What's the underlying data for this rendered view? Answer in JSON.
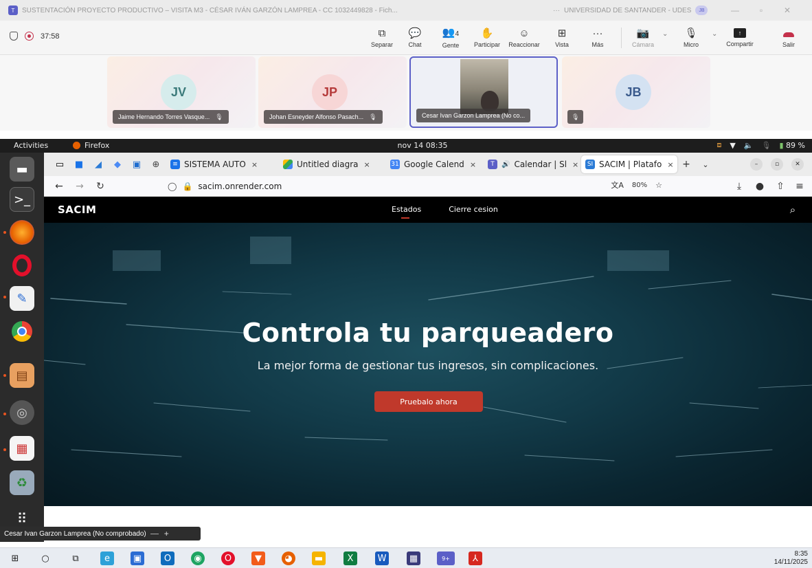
{
  "teams": {
    "window_title": "SUSTENTACIÓN PROYECTO PRODUCTIVO – VISITA M3 - CÉSAR IVÁN GARZÓN LAMPREA - CC 1032449828 - Fich...",
    "more": "···",
    "org": "UNIVERSIDAD DE SANTANDER - UDES",
    "org_badge": "JB",
    "timer": "37:58",
    "toolbar": {
      "separar": "Separar",
      "chat": "Chat",
      "gente": "Gente",
      "gente_count": "4",
      "participar": "Participar",
      "reaccionar": "Reaccionar",
      "vista": "Vista",
      "mas": "Más",
      "camara": "Cámara",
      "micro": "Micro",
      "compartir": "Compartir",
      "salir": "Salir"
    },
    "participants": [
      {
        "initials": "JV",
        "name": "Jaime Hernando Torres Vasque...",
        "bg": "#d6ecec",
        "fg": "#3b7a7a"
      },
      {
        "initials": "JP",
        "name": "Johan Esneyder Alfonso Pasach...",
        "bg": "#f7d6d6",
        "fg": "#b53a3a"
      },
      {
        "initials": "",
        "name": "Cesar Ivan Garzon Lamprea (No co..."
      },
      {
        "initials": "JB",
        "name": "",
        "bg": "#d4e2f2",
        "fg": "#3a5a8c"
      }
    ]
  },
  "gnome": {
    "activities": "Activities",
    "app": "Firefox",
    "clock": "nov 14  08:35",
    "battery": "89 %"
  },
  "firefox": {
    "tabs": [
      {
        "title": "SISTEMA AUTO",
        "close": "×"
      },
      {
        "title": "Untitled diagra",
        "close": "×"
      },
      {
        "title": "Google Calend",
        "close": "×"
      },
      {
        "title": "Calendar | Sl",
        "close": "×"
      },
      {
        "title": "SACIM | Platafo",
        "close": "×"
      }
    ],
    "url": "sacim.onrender.com",
    "zoom": "80%"
  },
  "site": {
    "brand": "SACIM",
    "nav": [
      "Estados",
      "Cierre cesion"
    ],
    "hero_title": "Controla tu parqueadero",
    "hero_subtitle": "La mejor forma de gestionar tus ingresos, sin complicaciones.",
    "cta": "Pruebalo ahora"
  },
  "sharing_bar": {
    "name": "Cesar Ivan Garzon Lamprea (No comprobado)",
    "plus": "+"
  },
  "taskbar": {
    "time": "8:35",
    "date": "14/11/2025",
    "badge": "9+"
  },
  "colors": {
    "teams_accent": "#5b5fc7",
    "leave_red": "#c4314b",
    "cta_red": "#c0392b",
    "ubuntu_orange": "#e95420"
  }
}
